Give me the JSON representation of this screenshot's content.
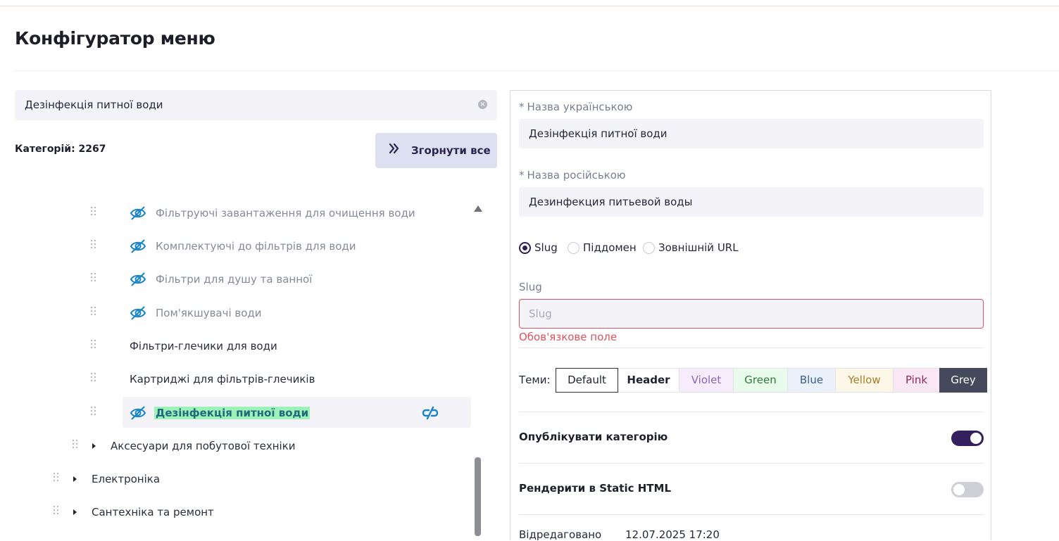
{
  "page": {
    "title": "Конфігуратор меню"
  },
  "search": {
    "value": "Дезінфекція питної води"
  },
  "categories": {
    "count_label": "Категорій: 2267"
  },
  "collapse": {
    "label": "Згорнути все"
  },
  "tree": {
    "items": [
      {
        "label": "Фільтруючі завантаження для очищення води",
        "hidden": true
      },
      {
        "label": "Комплектуючі до фільтрів для води",
        "hidden": true
      },
      {
        "label": "Фільтри для душу та ванної",
        "hidden": true
      },
      {
        "label": "Пом'якшувачі води",
        "hidden": true
      },
      {
        "label": "Фільтри-глечики для води",
        "hidden": false
      },
      {
        "label": "Картриджі для фільтрів-глечиків",
        "hidden": false
      },
      {
        "label": "Дезінфекція питної води",
        "hidden": true,
        "selected": true
      },
      {
        "label": "Аксесуари для побутової техніки",
        "expandable": true
      },
      {
        "label": "Електроніка",
        "expandable": true
      },
      {
        "label": "Сантехніка та ремонт",
        "expandable": true
      }
    ]
  },
  "form": {
    "name_ua": {
      "label": "Назва українською",
      "value": "Дезінфекція питної води"
    },
    "name_ru": {
      "label": "Назва російською",
      "value": "Дезинфекция питьевой воды"
    },
    "link_type": {
      "options": [
        "Slug",
        "Піддомен",
        "Зовнішній URL"
      ],
      "selected": "Slug"
    },
    "slug": {
      "label": "Slug",
      "placeholder": "Slug",
      "error": "Обов'язкове поле"
    },
    "themes": {
      "label": "Теми",
      "colon": ":",
      "options": [
        "Default",
        "Header",
        "Violet",
        "Green",
        "Blue",
        "Yellow",
        "Pink",
        "Grey"
      ],
      "selected": "Default"
    },
    "publish": {
      "label": "Опублікувати категорію",
      "on": true
    },
    "static_html": {
      "label": "Рендерити в Static HTML",
      "on": false
    },
    "edited": {
      "label": "Відредаговано",
      "value": "12.07.2025 17:20"
    }
  },
  "colors": {
    "accent": "#2f1f59",
    "hidden_icon": "#1a84c7",
    "error": "#e0535e",
    "highlight": "#9ef2b7"
  }
}
